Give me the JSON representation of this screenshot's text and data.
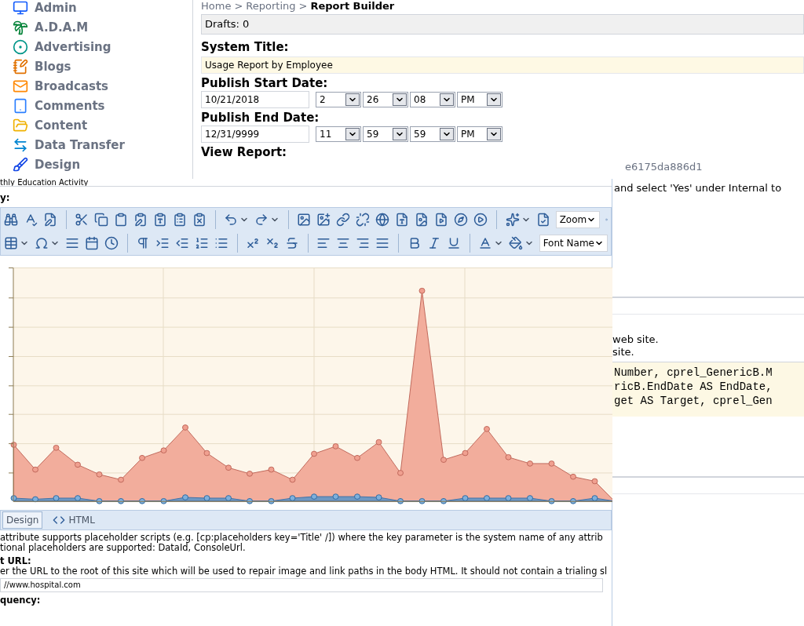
{
  "sidebar": {
    "items": [
      {
        "label": "Admin"
      },
      {
        "label": "A.D.A.M"
      },
      {
        "label": "Advertising"
      },
      {
        "label": "Blogs"
      },
      {
        "label": "Broadcasts"
      },
      {
        "label": "Comments"
      },
      {
        "label": "Content"
      },
      {
        "label": "Data Transfer"
      },
      {
        "label": "Design"
      }
    ]
  },
  "breadcrumb": {
    "items": [
      "Home",
      "Reporting"
    ],
    "separator": ">",
    "current": "Report Builder"
  },
  "drafts": "Drafts: 0",
  "system_title": {
    "label": "System Title:",
    "value": "Usage Report by Employee"
  },
  "publish_start": {
    "label": "Publish Start Date:",
    "date": "10/21/2018",
    "hour": "2",
    "minute": "26",
    "second": "08",
    "ampm": "PM"
  },
  "publish_end": {
    "label": "Publish End Date:",
    "date": "12/31/9999",
    "hour": "11",
    "minute": "59",
    "second": "59",
    "ampm": "PM"
  },
  "view_report": {
    "label": "View Report:",
    "url_tail": "e6175da886d1"
  },
  "right_panel": {
    "note": "and select 'Yes' under Internal to",
    "lines": [
      "web site.",
      "site."
    ],
    "code_lines": [
      "Number, cprel_GenericB.M",
      "ricB.EndDate AS EndDate,",
      "get AS Target, cprel_Gen"
    ]
  },
  "editor": {
    "title_value": "thly Education Activity",
    "body_label": "y:",
    "zoom": "Zoom",
    "font_name": "Font Name",
    "tabs": [
      {
        "label": "Design",
        "selected": true
      },
      {
        "label": "HTML",
        "selected": false
      }
    ],
    "help_lines": [
      "attribute supports placeholder scripts (e.g. [cp:placeholders key='Title' /]) where the key parameter is the system name of any attrib",
      "tional placeholders are supported: DataId, ConsoleUrl."
    ],
    "root_url": {
      "label": "t URL:",
      "help": "er the URL to the root of this site which will be used to repair image and link paths in the body HTML. It should not contain a trialing sl",
      "value": "//www.hospital.com"
    },
    "frequency_label": "quency:"
  }
}
